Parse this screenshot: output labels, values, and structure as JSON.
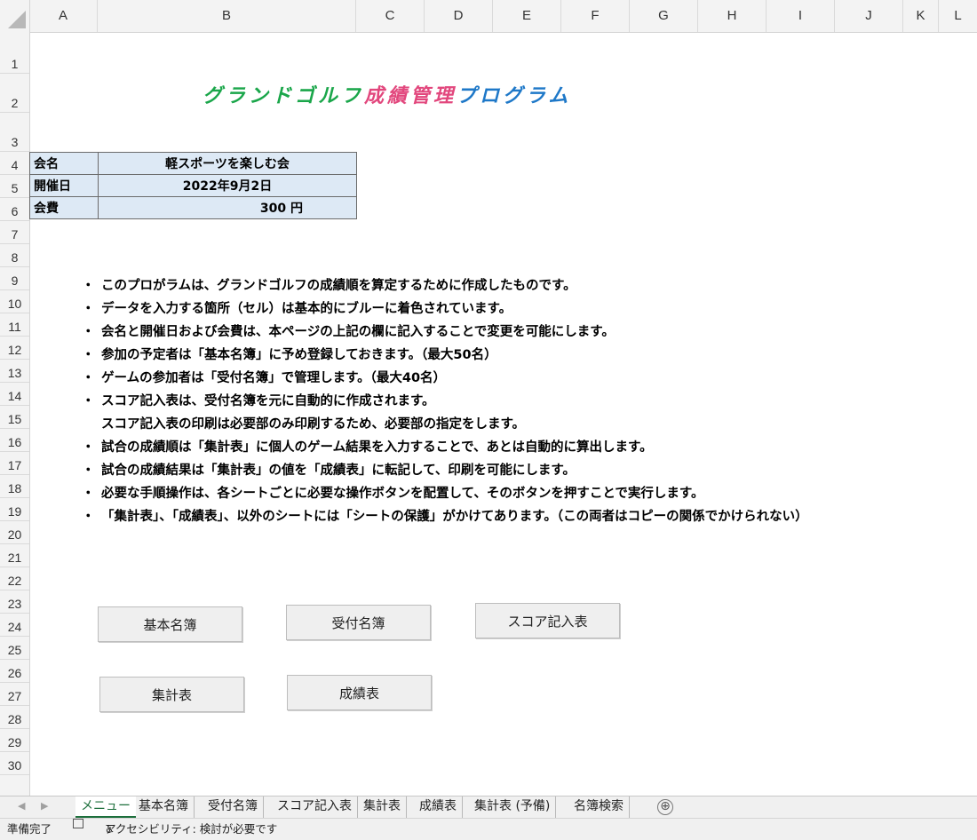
{
  "columns": [
    "A",
    "B",
    "C",
    "D",
    "E",
    "F",
    "G",
    "H",
    "I",
    "J",
    "K",
    "L"
  ],
  "rows": [
    "1",
    "2",
    "3",
    "4",
    "5",
    "6",
    "7",
    "8",
    "9",
    "10",
    "11",
    "12",
    "13",
    "14",
    "15",
    "16",
    "17",
    "18",
    "19",
    "20",
    "21",
    "22",
    "23",
    "24",
    "25",
    "26",
    "27",
    "28",
    "29",
    "30"
  ],
  "title": {
    "part1": "グランドゴルフ",
    "part2": "成績管理",
    "part3": "プログラム",
    "colors": {
      "part1": "#1aa64a",
      "part2": "#e2477d",
      "part3": "#1e78c8"
    }
  },
  "info": {
    "name_label": "会名",
    "name_value": "軽スポーツを楽しむ会",
    "date_label": "開催日",
    "date_value": "2022年9月2日",
    "fee_label": "会費",
    "fee_value": "300 円"
  },
  "notes": [
    {
      "bullet": "・",
      "text": "このプロがラムは、グランドゴルフの成績順を算定するために作成したものです。"
    },
    {
      "bullet": "・",
      "text": "データを入力する箇所（セル）は基本的にブルーに着色されています。"
    },
    {
      "bullet": "・",
      "text": "会名と開催日および会費は、本ページの上記の欄に記入することで変更を可能にします。"
    },
    {
      "bullet": "・",
      "text": "参加の予定者は「基本名簿」に予め登録しておきます。（最大50名）"
    },
    {
      "bullet": "・",
      "text": "ゲームの参加者は「受付名簿」で管理します。（最大40名）"
    },
    {
      "bullet": "・",
      "text": "スコア記入表は、受付名簿を元に自動的に作成されます。"
    },
    {
      "bullet": "",
      "text": "スコア記入表の印刷は必要部のみ印刷するため、必要部の指定をします。"
    },
    {
      "bullet": "・",
      "text": "試合の成績順は「集計表」に個人のゲーム結果を入力することで、あとは自動的に算出します。"
    },
    {
      "bullet": "・",
      "text": "試合の成績結果は「集計表」の値を「成績表」に転記して、印刷を可能にします。"
    },
    {
      "bullet": "・",
      "text": "必要な手順操作は、各シートごとに必要な操作ボタンを配置して、そのボタンを押すことで実行します。"
    },
    {
      "bullet": "・",
      "text": "「集計表」、「成績表」、以外のシートには「シートの保護」がかけてあります。（この両者はコピーの関係でかけられない）"
    }
  ],
  "buttons": {
    "basic": "基本名簿",
    "reception": "受付名簿",
    "score": "スコア記入表",
    "summary": "集計表",
    "results": "成績表"
  },
  "tabs": [
    "メニュー",
    "基本名簿",
    "受付名簿",
    "スコア記入表",
    "集計表",
    "成績表",
    "集計表 (予備)",
    "名簿検索"
  ],
  "tab_add": "⊕",
  "status": {
    "ready": "準備完了",
    "accessibility": "アクセシビリティ: 検討が必要です"
  }
}
